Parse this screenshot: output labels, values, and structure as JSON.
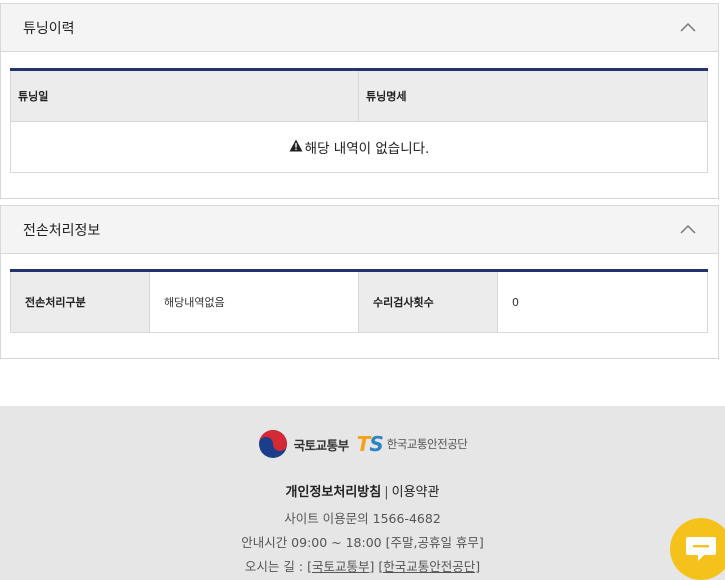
{
  "tuning_panel": {
    "title": "튜닝이력",
    "columns": [
      "튜닝일",
      "튜닝명세"
    ],
    "empty_message": "해당 내역이 없습니다."
  },
  "transfer_panel": {
    "title": "전손처리정보",
    "rows": [
      {
        "label1": "전손처리구분",
        "value1": "해당내역없음",
        "label2": "수리검사횟수",
        "value2": "0"
      }
    ]
  },
  "footer": {
    "logo_molit": "국토교통부",
    "logo_ts_mark_t": "T",
    "logo_ts_mark_s": "S",
    "logo_ts_name": "한국교통안전공단",
    "privacy": "개인정보처리방침",
    "separator": "|",
    "terms": "이용약관",
    "inquiry": "사이트 이용문의 1566-4682",
    "hours": "안내시간 09:00 ~ 18:00 [주말,공휴일 휴무]",
    "directions_label": "오시는 길 : ",
    "direction_links": [
      "[국토교통부]",
      "[한국교통안전공단]"
    ]
  },
  "colors": {
    "table_accent": "#23336d",
    "chat_button": "#f5c21b"
  },
  "icons": {
    "collapse": "chevron-up-icon",
    "warning": "warning-icon",
    "chat": "chat-bubble-icon"
  }
}
